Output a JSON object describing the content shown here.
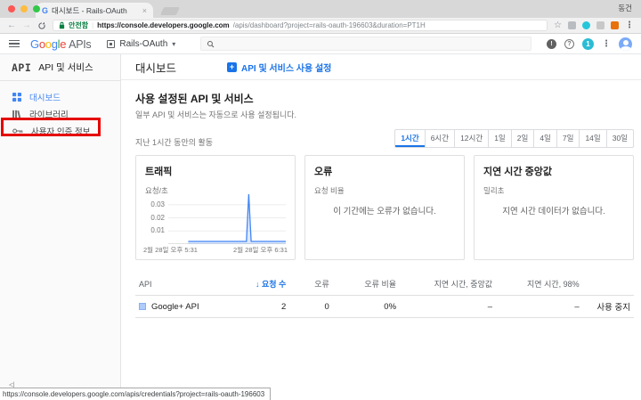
{
  "colors": {
    "accent_blue": "#1a73e8",
    "google_blue": "#4285f4",
    "annotation_red": "#e60000",
    "secure_green": "#0b8043",
    "notification_teal": "#2bbcd4"
  },
  "icons": {
    "back": "←",
    "forward": "→",
    "bookmark_star": "☆",
    "browser_menu": "⋮",
    "header_more": "⋮",
    "sort_desc": "↓",
    "chevron_down": "▾",
    "tab_close": "×",
    "feedback": "!",
    "help": "?",
    "collapse": "<|",
    "plus": "+"
  },
  "browser": {
    "tab_title": "대시보드 - Rails-OAuth",
    "profile_name": "동건",
    "security_label": "안전함",
    "url_host": "https://console.developers.google.com",
    "url_path": "/apis/dashboard?project=rails-oauth-196603&duration=PT1H"
  },
  "header": {
    "logo_letters": [
      "G",
      "o",
      "o",
      "g",
      "l",
      "e"
    ],
    "logo_suffix": "APIs",
    "project_name": "Rails-OAuth",
    "notification_count": "1"
  },
  "sidebar": {
    "logo": "API",
    "title": "API 및 서비스",
    "items": [
      {
        "label": "대시보드"
      },
      {
        "label": "라이브러리"
      },
      {
        "label": "사용자 인증 정보"
      }
    ]
  },
  "main": {
    "page_title": "대시보드",
    "enable_button": "API 및 서비스 사용 설정",
    "section_title": "사용 설정된 API 및 서비스",
    "section_subtitle": "일부 API 및 서비스는 자동으로 사용 설정됩니다.",
    "activity_label": "지난 1시간 동안의 활동",
    "time_ranges": [
      "1시간",
      "6시간",
      "12시간",
      "1일",
      "2일",
      "4일",
      "7일",
      "14일",
      "30일"
    ],
    "cards": {
      "errors": {
        "title": "오류",
        "unit": "요청 비율",
        "empty_message": "이 기간에는 오류가 없습니다."
      },
      "latency": {
        "title": "지연 시간 중앙값",
        "unit": "밀리초",
        "empty_message": "지연 시간 데이터가 없습니다."
      }
    },
    "table": {
      "headers": {
        "api": "API",
        "requests": "요청 수",
        "errors": "오류",
        "error_rate": "오류 비율",
        "latency_median": "지연 시간, 중앙값",
        "latency_98": "지연 시간, 98%"
      },
      "rows": [
        {
          "api": "Google+ API",
          "requests": "2",
          "errors": "0",
          "error_rate": "0%",
          "latency_median": "–",
          "latency_98": "–",
          "action": "사용 중지"
        }
      ]
    }
  },
  "chart_data": {
    "type": "area",
    "title": "트래픽",
    "ylabel": "요청/초",
    "yticks": [
      0.01,
      0.02,
      0.03
    ],
    "ylim": [
      0,
      0.04
    ],
    "x_start_label": "2월 28일 오후 5:31",
    "x_end_label": "2월 28일 오후 6:31",
    "grid": true,
    "legend": "none",
    "series": [
      {
        "name": "요청/초",
        "points": [
          [
            0.17,
            0.002
          ],
          [
            0.665,
            0.002
          ],
          [
            0.685,
            0.038
          ],
          [
            0.705,
            0.002
          ],
          [
            1.0,
            0.002
          ]
        ]
      }
    ]
  },
  "status_bar": {
    "url": "https://console.developers.google.com/apis/credentials?project=rails-oauth-196603"
  }
}
